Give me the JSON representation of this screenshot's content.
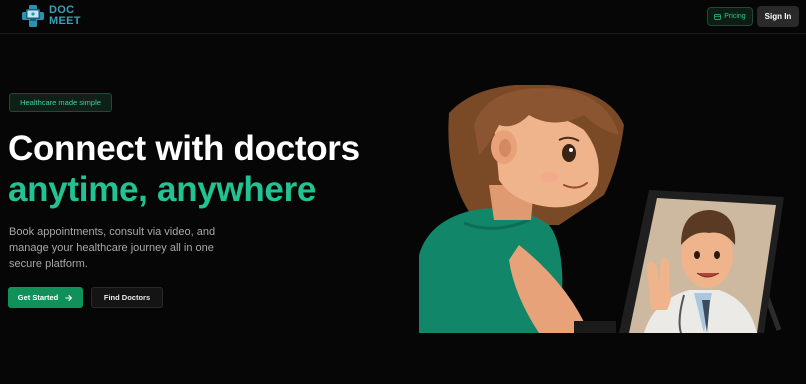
{
  "header": {
    "logo": {
      "line1": "DOC",
      "line2": "MEET",
      "icon": "medical-cross-icon"
    },
    "pricing_label": "Pricing",
    "pricing_icon": "card-icon",
    "signin_label": "Sign In"
  },
  "hero": {
    "badge": "Healthcare made simple",
    "title_line1": "Connect with doctors",
    "title_line2": "anytime, anywhere",
    "description": "Book appointments, consult via video, and manage your healthcare journey all in one secure platform.",
    "primary_cta": "Get Started",
    "primary_cta_icon": "arrow-right-icon",
    "secondary_cta": "Find Doctors",
    "illustration": "girl-video-call-with-doctor-illustration"
  },
  "colors": {
    "background": "#060606",
    "accent": "#23c391",
    "button_green": "#10915a",
    "logo_blue": "#3aa0b8"
  }
}
